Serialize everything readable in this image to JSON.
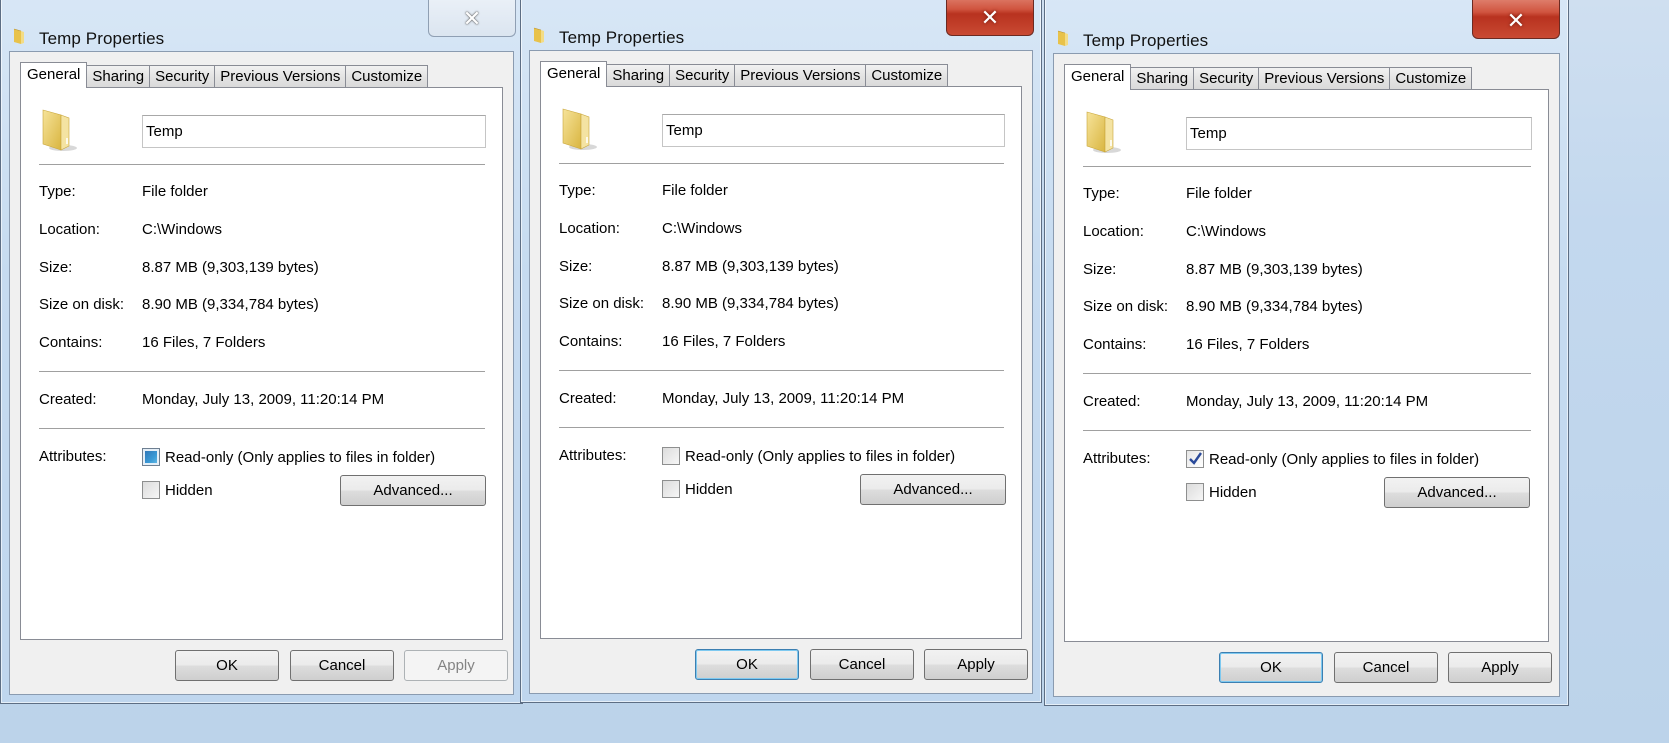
{
  "dialogs": [
    {
      "title": "Temp Properties",
      "close_label": "✕",
      "close_style": "inactive",
      "tabs": [
        "General",
        "Sharing",
        "Security",
        "Previous Versions",
        "Customize"
      ],
      "active_tab": "General",
      "folder_name": "Temp",
      "fields": [
        {
          "label": "Type:",
          "value": "File folder"
        },
        {
          "label": "Location:",
          "value": "C:\\Windows"
        },
        {
          "label": "Size:",
          "value": "8.87 MB (9,303,139 bytes)"
        },
        {
          "label": "Size on disk:",
          "value": "8.90 MB (9,334,784 bytes)"
        },
        {
          "label": "Contains:",
          "value": "16 Files, 7 Folders"
        }
      ],
      "created_label": "Created:",
      "created_value": "Monday, July 13, 2009, 11:20:14 PM",
      "attributes_label": "Attributes:",
      "readonly_label": "Read-only (Only applies to files in folder)",
      "readonly_state": "indeterminate",
      "hidden_label": "Hidden",
      "hidden_state": "unchecked",
      "advanced_label": "Advanced...",
      "buttons": {
        "ok": "OK",
        "cancel": "Cancel",
        "apply": "Apply"
      },
      "apply_enabled": false,
      "ok_default": false
    },
    {
      "title": "Temp Properties",
      "close_label": "✕",
      "close_style": "active",
      "tabs": [
        "General",
        "Sharing",
        "Security",
        "Previous Versions",
        "Customize"
      ],
      "active_tab": "General",
      "folder_name": "Temp",
      "fields": [
        {
          "label": "Type:",
          "value": "File folder"
        },
        {
          "label": "Location:",
          "value": "C:\\Windows"
        },
        {
          "label": "Size:",
          "value": "8.87 MB (9,303,139 bytes)"
        },
        {
          "label": "Size on disk:",
          "value": "8.90 MB (9,334,784 bytes)"
        },
        {
          "label": "Contains:",
          "value": "16 Files, 7 Folders"
        }
      ],
      "created_label": "Created:",
      "created_value": "Monday, July 13, 2009, 11:20:14 PM",
      "attributes_label": "Attributes:",
      "readonly_label": "Read-only (Only applies to files in folder)",
      "readonly_state": "unchecked",
      "hidden_label": "Hidden",
      "hidden_state": "unchecked",
      "advanced_label": "Advanced...",
      "buttons": {
        "ok": "OK",
        "cancel": "Cancel",
        "apply": "Apply"
      },
      "apply_enabled": true,
      "ok_default": true
    },
    {
      "title": "Temp Properties",
      "close_label": "✕",
      "close_style": "active",
      "tabs": [
        "General",
        "Sharing",
        "Security",
        "Previous Versions",
        "Customize"
      ],
      "active_tab": "General",
      "folder_name": "Temp",
      "fields": [
        {
          "label": "Type:",
          "value": "File folder"
        },
        {
          "label": "Location:",
          "value": "C:\\Windows"
        },
        {
          "label": "Size:",
          "value": "8.87 MB (9,303,139 bytes)"
        },
        {
          "label": "Size on disk:",
          "value": "8.90 MB (9,334,784 bytes)"
        },
        {
          "label": "Contains:",
          "value": "16 Files, 7 Folders"
        }
      ],
      "created_label": "Created:",
      "created_value": "Monday, July 13, 2009, 11:20:14 PM",
      "attributes_label": "Attributes:",
      "readonly_label": "Read-only (Only applies to files in folder)",
      "readonly_state": "checked",
      "hidden_label": "Hidden",
      "hidden_state": "unchecked",
      "advanced_label": "Advanced...",
      "buttons": {
        "ok": "OK",
        "cancel": "Cancel",
        "apply": "Apply"
      },
      "apply_enabled": true,
      "ok_default": true
    }
  ],
  "colors": {
    "close_active": "#c94a33",
    "default_button_border": "#3c7fb1",
    "indeterminate_fill": "#3a9ad6",
    "check_mark": "#2a4a9a"
  }
}
